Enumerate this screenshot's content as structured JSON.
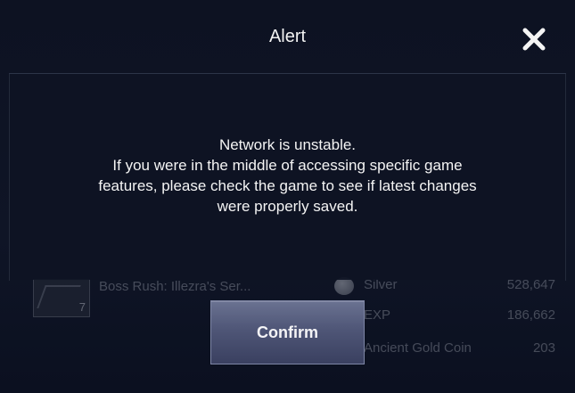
{
  "alert": {
    "title": "Alert",
    "close_icon": "close-icon",
    "message_lines": [
      "Network is unstable.",
      "If you were in the middle of accessing specific game",
      "features, please check the game to see if latest changes",
      "were properly saved."
    ],
    "confirm_label": "Confirm"
  },
  "background": {
    "boss": {
      "name": "Boss Rush: Illezra's Ser...",
      "level": "7"
    },
    "rewards": [
      {
        "icon": "silver-coin-icon",
        "name": "Silver",
        "value": "528,647"
      },
      {
        "icon": "",
        "name": "EXP",
        "value": "186,662"
      },
      {
        "icon": "",
        "name": "Ancient Gold Coin",
        "value": "203"
      }
    ]
  },
  "colors": {
    "background": "#0c1120",
    "panel": "#0e1323",
    "button": "#4f5677",
    "text": "#f4f4f4"
  }
}
